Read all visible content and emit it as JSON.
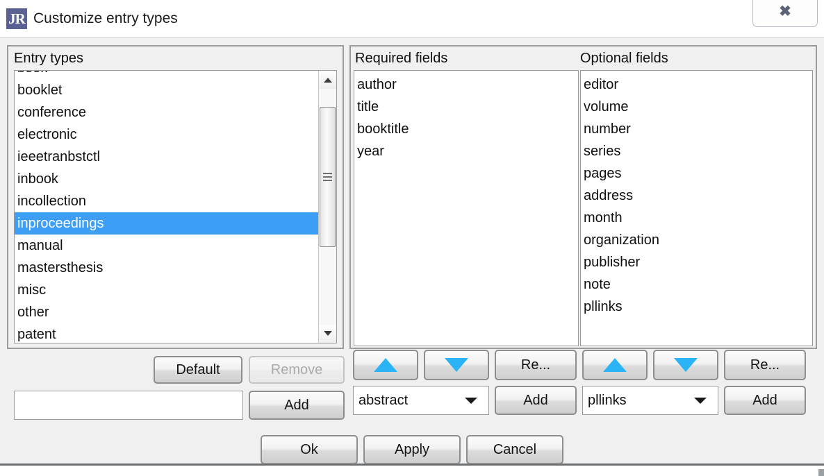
{
  "window": {
    "title": "Customize entry types",
    "app_icon": "JR",
    "close_button_label": "✖",
    "close_icon_name": "close-icon"
  },
  "entry_types_panel": {
    "title": "Entry types",
    "items": [
      "book",
      "booklet",
      "conference",
      "electronic",
      "ieeetranbstctl",
      "inbook",
      "incollection",
      "inproceedings",
      "manual",
      "mastersthesis",
      "misc",
      "other",
      "patent"
    ],
    "selected": "inproceedings",
    "selection_color": "#3d9ef5",
    "scroll_position": "partial",
    "buttons": {
      "default": "Default",
      "remove": "Remove",
      "remove_disabled": true,
      "add": "Add"
    },
    "new_type_input": {
      "value": "",
      "placeholder": ""
    }
  },
  "required_fields_panel": {
    "title": "Required fields",
    "items": [
      "author",
      "title",
      "booktitle",
      "year"
    ],
    "buttons": {
      "move_up": "",
      "move_down": "",
      "remove": "Re...",
      "add": "Add"
    },
    "field_selector": {
      "value": "abstract"
    }
  },
  "optional_fields_panel": {
    "title": "Optional fields",
    "items": [
      "editor",
      "volume",
      "number",
      "series",
      "pages",
      "address",
      "month",
      "organization",
      "publisher",
      "note",
      "pllinks"
    ],
    "buttons": {
      "move_up": "",
      "move_down": "",
      "remove": "Re...",
      "add": "Add"
    },
    "field_selector": {
      "value": "pllinks"
    }
  },
  "dialog_buttons": {
    "ok": "Ok",
    "apply": "Apply",
    "cancel": "Cancel"
  }
}
